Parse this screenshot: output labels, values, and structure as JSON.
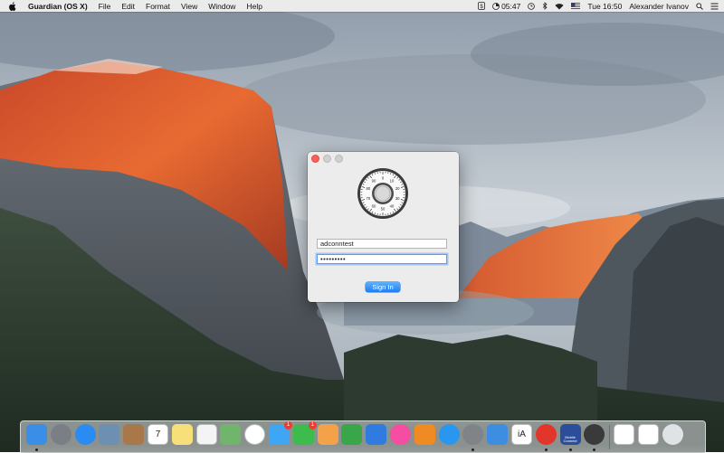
{
  "menubar": {
    "app_name": "Guardian (OS X)",
    "menus": [
      "File",
      "Edit",
      "Format",
      "View",
      "Window",
      "Help"
    ],
    "status_time_small": "05:47",
    "clock": "Tue 16:50",
    "user": "Alexander Ivanov",
    "status_icons": [
      "dollar-status-icon",
      "pie-chart-status-icon",
      "clock-status-icon",
      "bluetooth-icon",
      "wifi-icon",
      "flag-icon",
      "spotlight-icon",
      "list-icon"
    ]
  },
  "login": {
    "username": "adconntest",
    "password_mask": "•••••••••",
    "signin_label": "Sign In",
    "dial_numbers": [
      "0",
      "10",
      "20",
      "30",
      "40",
      "50",
      "60",
      "70",
      "80",
      "90"
    ]
  },
  "dock": {
    "items": [
      {
        "name": "finder",
        "color": "#3a8ee6"
      },
      {
        "name": "launchpad",
        "color": "#7a7f86"
      },
      {
        "name": "safari",
        "color": "#2a8bf2"
      },
      {
        "name": "preview",
        "color": "#6d8fb1"
      },
      {
        "name": "contacts",
        "color": "#a9784a"
      },
      {
        "name": "calendar",
        "color": "#ffffff",
        "label": "7"
      },
      {
        "name": "notes",
        "color": "#f7e079"
      },
      {
        "name": "reminders",
        "color": "#f4f4f4"
      },
      {
        "name": "maps",
        "color": "#6fb66c"
      },
      {
        "name": "photos",
        "color": "#ffffff"
      },
      {
        "name": "messages",
        "color": "#3fa6f5",
        "badge": "1"
      },
      {
        "name": "facetime",
        "color": "#3dbb4c",
        "badge": "1"
      },
      {
        "name": "pages",
        "color": "#f3a24a"
      },
      {
        "name": "numbers",
        "color": "#3aa64a"
      },
      {
        "name": "keynote",
        "color": "#2f7be0"
      },
      {
        "name": "itunes",
        "color": "#f44da2"
      },
      {
        "name": "ibooks",
        "color": "#f08a22"
      },
      {
        "name": "app-store",
        "color": "#2997f0"
      },
      {
        "name": "system-preferences",
        "color": "#808388"
      },
      {
        "name": "xcode",
        "color": "#3d8ee0"
      },
      {
        "name": "ia-writer",
        "color": "#ffffff",
        "label": "iA"
      },
      {
        "name": "tomato",
        "color": "#e2352b"
      },
      {
        "name": "mobile-connect",
        "color": "#2c4e9a",
        "label": "Mobile Connect"
      },
      {
        "name": "guardian",
        "color": "#3a3a3a"
      },
      {
        "name": "documents",
        "color": "#ffffff"
      },
      {
        "name": "downloads",
        "color": "#ffffff"
      },
      {
        "name": "trash",
        "color": "#dfe3e6"
      }
    ]
  }
}
